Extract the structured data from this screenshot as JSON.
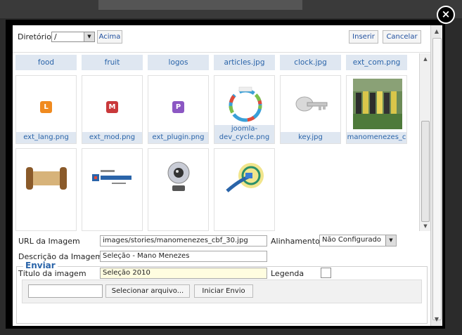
{
  "close_label": "×",
  "toolbar": {
    "dir_label": "Diretório",
    "dir_value": "/",
    "up_button": "Acima",
    "insert_button": "Inserir",
    "cancel_button": "Cancelar"
  },
  "folders": [
    "food",
    "fruit",
    "logos",
    "articles.jpg",
    "clock.jpg",
    "ext_com.png"
  ],
  "tiles_row2": [
    {
      "caption": "ext_lang.png",
      "letter": "L"
    },
    {
      "caption": "ext_mod.png",
      "letter": "M"
    },
    {
      "caption": "ext_plugin.png",
      "letter": "P"
    },
    {
      "caption": "joomla-dev_cycle.png"
    },
    {
      "caption": "key.jpg"
    },
    {
      "caption": "manomenezes_c"
    }
  ],
  "icon_colors": {
    "L": "#f08a1f",
    "M": "#c9383a",
    "P": "#8b57c3"
  },
  "form": {
    "url_label": "URL da Imagem",
    "url_value": "images/stories/manomenezes_cbf_30.jpg",
    "align_label": "Alinhamento",
    "align_value": "Não Configurado",
    "desc_label": "Descrição da Imagem",
    "desc_value": "Seleção - Mano Menezes",
    "title_label": "Título da imagem",
    "title_value": "Seleção 2010",
    "caption_label": "Legenda"
  },
  "upload": {
    "legend": "Enviar",
    "file_value": "",
    "browse_button": "Selecionar arquivo...",
    "start_button": "Iniciar Envio"
  }
}
